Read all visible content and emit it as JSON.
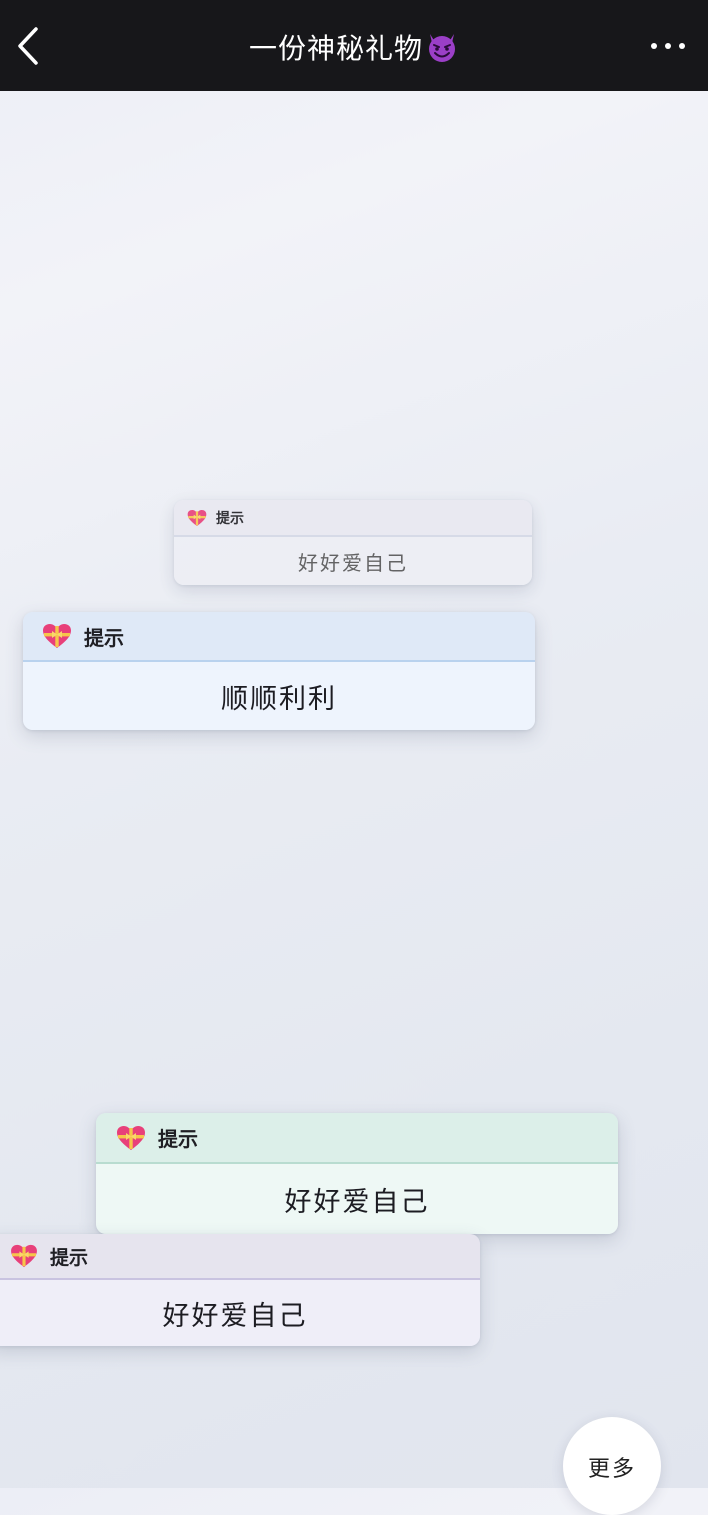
{
  "header": {
    "title": "一份神秘礼物",
    "title_emoji": "smiling-devil-emoji"
  },
  "cards": [
    {
      "id": "card1",
      "label": "提示",
      "message": "好好爱自己",
      "icon": "heart-with-ribbon-icon",
      "accent": "#d4d8e6"
    },
    {
      "id": "card2",
      "label": "提示",
      "message": "顺顺利利",
      "icon": "heart-with-ribbon-icon",
      "accent": "#b9d2ee"
    },
    {
      "id": "card3",
      "label": "提示",
      "message": "好好爱自己",
      "icon": "heart-with-ribbon-icon",
      "accent": "#b8dcd0"
    },
    {
      "id": "card4",
      "label": "提示",
      "message": "好好爱自己",
      "icon": "heart-with-ribbon-icon",
      "accent": "#c9c3e0"
    }
  ],
  "more_button": {
    "label": "更多"
  },
  "colors": {
    "topbar": "#17171a",
    "heart": "#e8407a",
    "ribbon": "#f6c64a",
    "devil": "#9b3fc7"
  }
}
